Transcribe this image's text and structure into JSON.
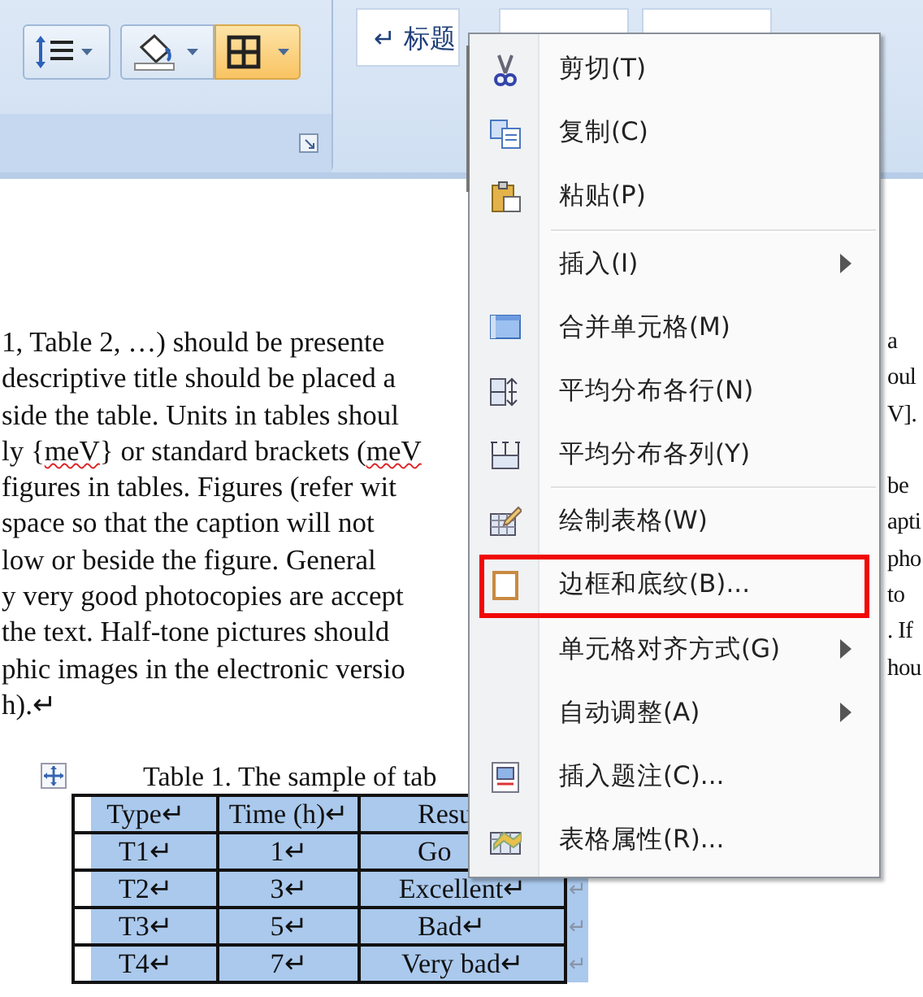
{
  "ribbon": {
    "style_gallery": [
      {
        "label": "↵ 标题"
      }
    ],
    "buttons": [
      {
        "kind": "line-spacing",
        "active": false
      },
      {
        "kind": "shading",
        "active": false
      },
      {
        "kind": "borders",
        "active": true
      }
    ]
  },
  "document": {
    "lines": [
      {
        "left": [
          {
            "text": "1, Table 2, …) should be presente",
            "misspelled": false
          }
        ],
        "right": "a"
      },
      {
        "left": [
          {
            "text": "descriptive title should be placed a",
            "misspelled": false
          }
        ],
        "right": "oul"
      },
      {
        "left": [
          {
            "text": "side the table. Units in tables shoul",
            "misspelled": false
          }
        ],
        "right": "V]."
      },
      {
        "left": [
          {
            "text": "ly {",
            "misspelled": false
          },
          {
            "text": "meV",
            "misspelled": true
          },
          {
            "text": "} or standard brackets (",
            "misspelled": false
          },
          {
            "text": "meV",
            "misspelled": true
          }
        ]
      },
      {
        "left": [
          {
            "text": "figures in tables. Figures (refer wit",
            "misspelled": false
          }
        ],
        "right": "be"
      },
      {
        "left": [
          {
            "text": "space so that the caption will not",
            "misspelled": false
          }
        ],
        "right": "apti"
      },
      {
        "left": [
          {
            "text": "low or beside the figure. General",
            "misspelled": false
          }
        ],
        "right": "pho"
      },
      {
        "left": [
          {
            "text": "y very good photocopies are accept",
            "misspelled": false
          }
        ],
        "right": "to"
      },
      {
        "left": [
          {
            "text": "the text. Half-tone pictures should",
            "misspelled": false
          }
        ],
        "right": ". If"
      },
      {
        "left": [
          {
            "text": "phic images in the electronic versio",
            "misspelled": false
          }
        ],
        "right": "hou"
      },
      {
        "left": [
          {
            "text": "h).↵",
            "misspelled": false
          }
        ]
      }
    ],
    "table_caption": "Table 1. The sample of tab",
    "table": {
      "rows": [
        {
          "selected": true,
          "cells": [
            "Type↵",
            "Time (h)↵",
            "Resu"
          ],
          "end_mark": ""
        },
        {
          "selected": true,
          "cells": [
            "T1↵",
            "1↵",
            "Go"
          ],
          "end_mark": ""
        },
        {
          "selected": true,
          "cells": [
            "T2↵",
            "3↵",
            "Excellent↵"
          ],
          "end_mark": "↵"
        },
        {
          "selected": true,
          "cells": [
            "T3↵",
            "5↵",
            "Bad↵"
          ],
          "end_mark": "↵"
        },
        {
          "selected": true,
          "cells": [
            "T4↵",
            "7↵",
            "Very bad↵"
          ],
          "end_mark": "↵"
        }
      ]
    }
  },
  "context_menu": {
    "items": [
      {
        "kind": "command",
        "label": "剪切(T)",
        "submenu": false,
        "annotated": false
      },
      {
        "kind": "command",
        "label": "复制(C)",
        "submenu": false,
        "annotated": false
      },
      {
        "kind": "command",
        "label": "粘贴(P)",
        "submenu": false,
        "annotated": false
      },
      {
        "kind": "separator"
      },
      {
        "kind": "command",
        "label": "插入(I)",
        "submenu": true,
        "annotated": false
      },
      {
        "kind": "command",
        "label": "合并单元格(M)",
        "submenu": false,
        "annotated": false
      },
      {
        "kind": "command",
        "label": "平均分布各行(N)",
        "submenu": false,
        "annotated": false
      },
      {
        "kind": "command",
        "label": "平均分布各列(Y)",
        "submenu": false,
        "annotated": false
      },
      {
        "kind": "separator"
      },
      {
        "kind": "command",
        "label": "绘制表格(W)",
        "submenu": false,
        "annotated": false
      },
      {
        "kind": "command",
        "label": "边框和底纹(B)...",
        "submenu": false,
        "annotated": true
      },
      {
        "kind": "command",
        "label": "单元格对齐方式(G)",
        "submenu": true,
        "annotated": false
      },
      {
        "kind": "command",
        "label": "自动调整(A)",
        "submenu": true,
        "annotated": false
      },
      {
        "kind": "command",
        "label": "插入题注(C)...",
        "submenu": false,
        "annotated": false
      },
      {
        "kind": "command",
        "label": "表格属性(R)...",
        "submenu": false,
        "annotated": false
      }
    ]
  }
}
